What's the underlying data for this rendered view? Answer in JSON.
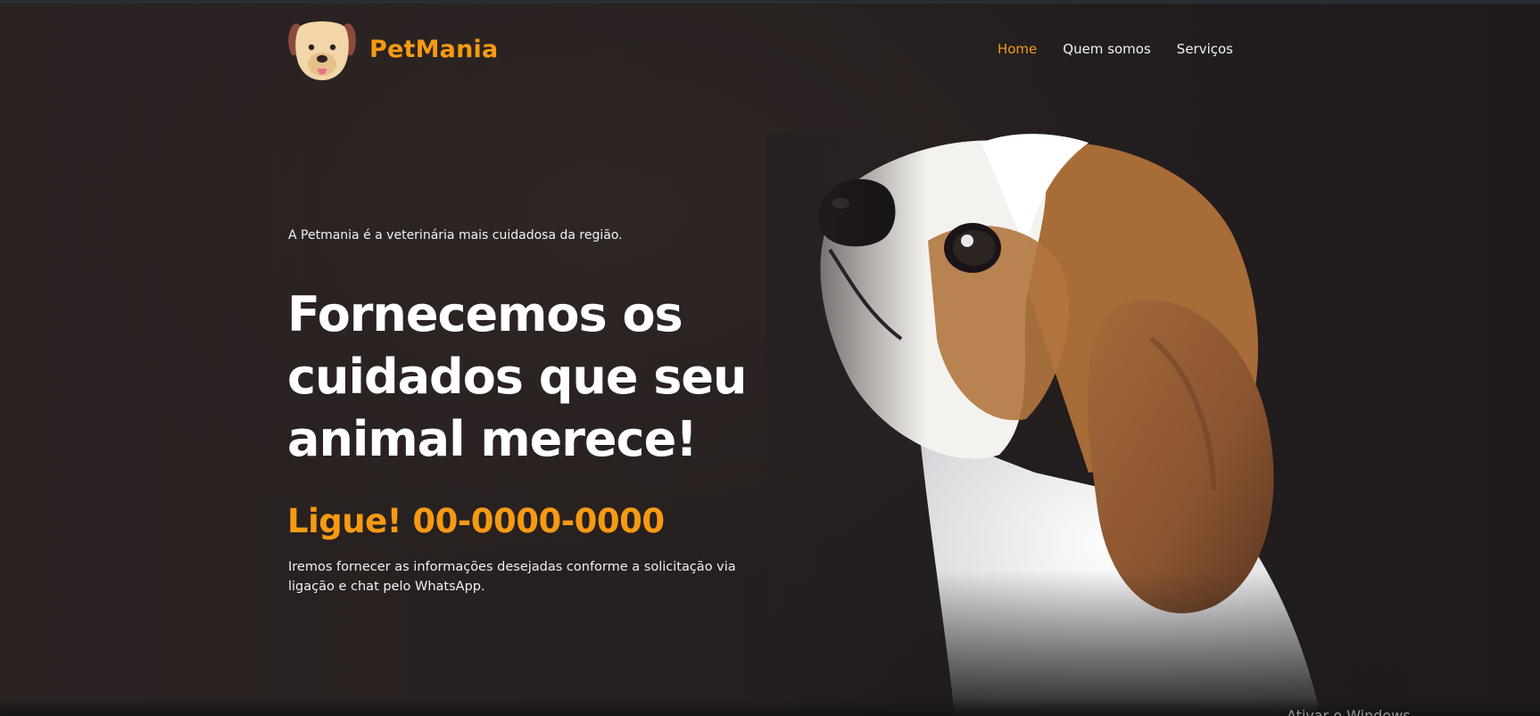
{
  "header": {
    "brand": "PetMania",
    "nav": [
      {
        "label": "Home",
        "active": true
      },
      {
        "label": "Quem somos",
        "active": false
      },
      {
        "label": "Serviços",
        "active": false
      }
    ]
  },
  "hero": {
    "subtitle": "A Petmania é a veterinária mais cuidadosa da região.",
    "headline": "Fornecemos os cuidados que seu animal merece!",
    "phone": "Ligue! 00-0000-0000",
    "info": "Iremos fornecer as informações desejadas conforme a solicitação via ligação e chat pelo WhatsApp."
  },
  "icons": {
    "logo": "dog-face-icon",
    "hero_image": "beagle-puppy"
  },
  "colors": {
    "accent": "#f59a14",
    "background": "#241e1f",
    "text": "#ffffff"
  },
  "watermark": "Ativar o Windows"
}
